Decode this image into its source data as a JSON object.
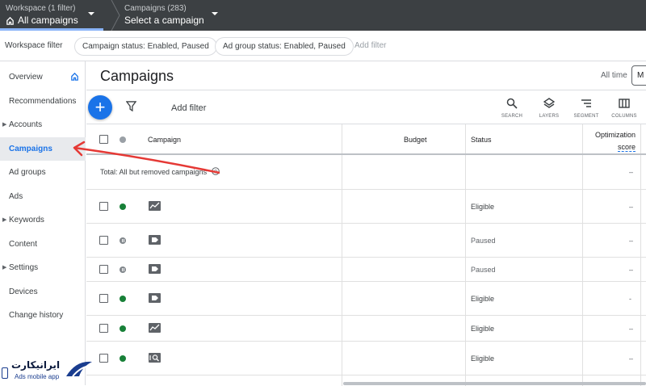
{
  "topbar": {
    "workspace_small": "Workspace (1 filter)",
    "workspace_big": "All campaigns",
    "campaigns_small": "Campaigns (283)",
    "campaigns_big": "Select a campaign"
  },
  "filterbar": {
    "label": "Workspace filter",
    "chips": [
      "Campaign status: Enabled, Paused",
      "Ad group status: Enabled, Paused"
    ],
    "add_filter": "Add filter"
  },
  "sidebar": {
    "items": [
      {
        "label": "Overview",
        "expandable": false
      },
      {
        "label": "Recommendations",
        "expandable": false
      },
      {
        "label": "Accounts",
        "expandable": true
      },
      {
        "label": "Campaigns",
        "expandable": false,
        "active": true
      },
      {
        "label": "Ad groups",
        "expandable": false
      },
      {
        "label": "Ads",
        "expandable": false
      },
      {
        "label": "Keywords",
        "expandable": true
      },
      {
        "label": "Content",
        "expandable": false
      },
      {
        "label": "Settings",
        "expandable": true
      },
      {
        "label": "Devices",
        "expandable": false
      },
      {
        "label": "Change history",
        "expandable": false
      }
    ]
  },
  "main": {
    "title": "Campaigns",
    "date_label": "All time",
    "date_value": "M",
    "add_filter": "Add filter",
    "tools": [
      "SEARCH",
      "LAYERS",
      "SEGMENT",
      "COLUMNS"
    ]
  },
  "table": {
    "headers": {
      "campaign": "Campaign",
      "budget": "Budget",
      "status": "Status",
      "opt_line1": "Optimization",
      "opt_line2": "score"
    },
    "total_label": "Total: All but removed campaigns",
    "total_opt": "–",
    "rows": [
      {
        "dot": "green",
        "type_icon": "display-campaign-icon",
        "status": "Eligible",
        "opt": "–"
      },
      {
        "dot": "paused",
        "type_icon": "shopping-campaign-icon",
        "status": "Paused",
        "opt": "–"
      },
      {
        "dot": "paused",
        "type_icon": "shopping-campaign-icon",
        "status": "Paused",
        "opt": "–"
      },
      {
        "dot": "green",
        "type_icon": "shopping-campaign-icon",
        "status": "Eligible",
        "opt": "-"
      },
      {
        "dot": "green",
        "type_icon": "display-campaign-icon",
        "status": "Eligible",
        "opt": "–"
      },
      {
        "dot": "green",
        "type_icon": "search-campaign-icon",
        "status": "Eligible",
        "opt": "–"
      }
    ]
  },
  "watermark": {
    "text": "ایرانیکارت",
    "sub": "Ads mobile app"
  },
  "colors": {
    "accent": "#1a73e8",
    "topbar": "#3c4043",
    "annotation": "#e53935",
    "eligible": "#188038"
  }
}
